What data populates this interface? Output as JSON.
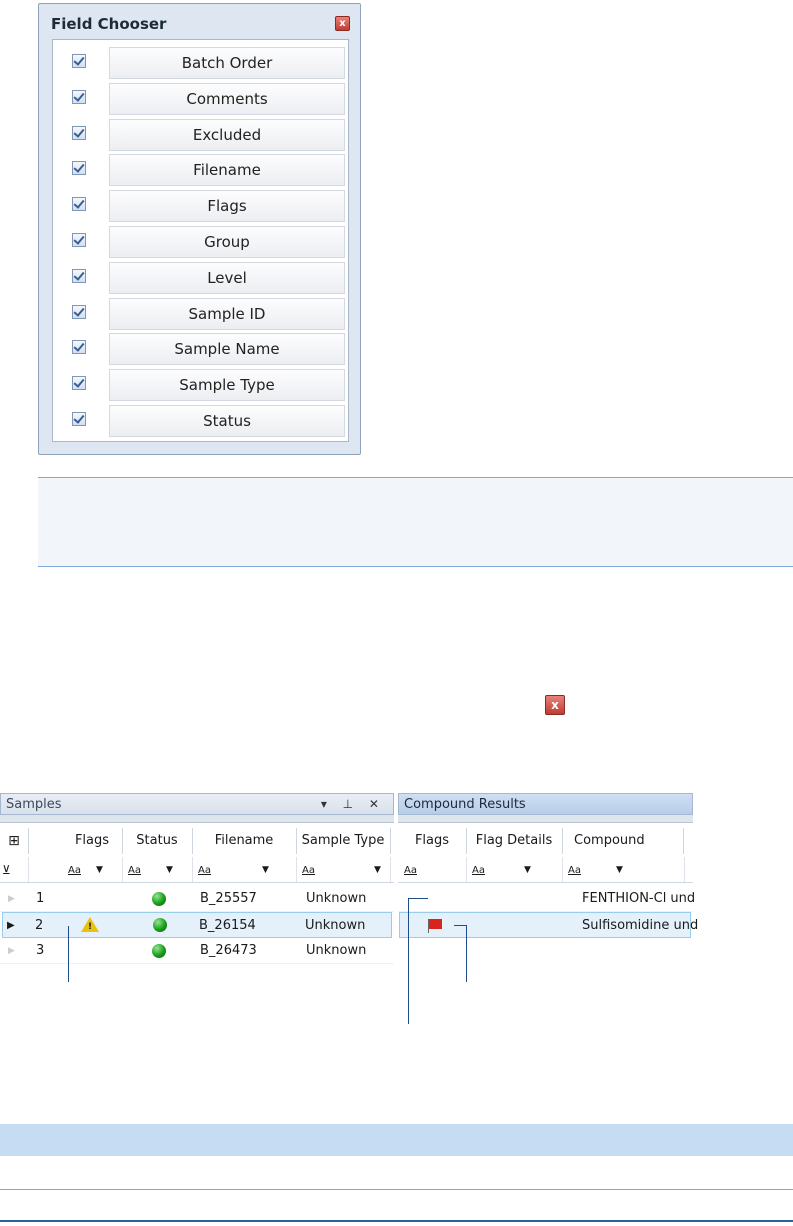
{
  "field_chooser": {
    "title": "Field Chooser",
    "close_label": "x",
    "fields": [
      {
        "label": "Batch Order",
        "checked": true
      },
      {
        "label": "Comments",
        "checked": true
      },
      {
        "label": "Excluded",
        "checked": true
      },
      {
        "label": "Filename",
        "checked": true
      },
      {
        "label": "Flags",
        "checked": true
      },
      {
        "label": "Group",
        "checked": true
      },
      {
        "label": "Level",
        "checked": true
      },
      {
        "label": "Sample ID",
        "checked": true
      },
      {
        "label": "Sample Name",
        "checked": true
      },
      {
        "label": "Sample Type",
        "checked": true
      },
      {
        "label": "Status",
        "checked": true
      }
    ]
  },
  "standalone_close": {
    "label": "x"
  },
  "samples": {
    "title": "Samples",
    "header_icons": "▾ ⊥ ✕",
    "columns": [
      "Flags",
      "Status",
      "Filename",
      "Sample Type"
    ],
    "filter_label": "Aa",
    "rows": [
      {
        "num": "1",
        "flag": "",
        "status": "green",
        "filename": "B_25557",
        "sample_type": "Unknown"
      },
      {
        "num": "2",
        "flag": "warning",
        "status": "green",
        "filename": "B_26154",
        "sample_type": "Unknown"
      },
      {
        "num": "3",
        "flag": "",
        "status": "green",
        "filename": "B_26473",
        "sample_type": "Unknown"
      }
    ]
  },
  "compound_results": {
    "title": "Compound Results",
    "columns": [
      "Flags",
      "Flag Details",
      "Compound"
    ],
    "filter_label": "Aa",
    "rows": [
      {
        "flag": "",
        "compound": "FENTHION-Cl und"
      },
      {
        "flag": "red-flag",
        "compound": "Sulfisomidine und"
      }
    ]
  },
  "colors": {
    "accent": "#1f4e8c",
    "panel": "#dde6f1",
    "status_green": "#1a9c1a",
    "flag_red": "#d9231d"
  }
}
